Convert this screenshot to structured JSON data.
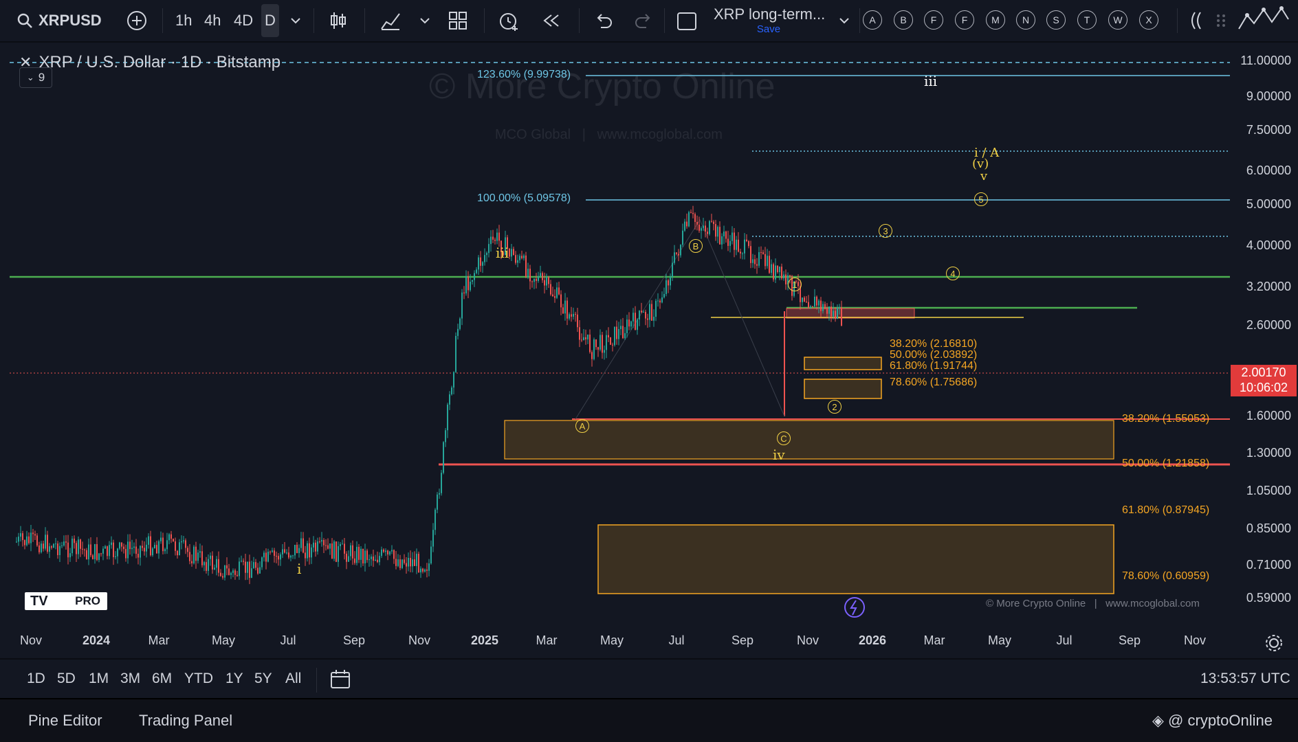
{
  "toolbar": {
    "symbol": "XRPUSD",
    "intervals": [
      "1h",
      "4h",
      "4D",
      "D"
    ],
    "active_interval": "D",
    "layout_name": "XRP long-term...",
    "save_label": "Save",
    "drawing_letters": [
      "A",
      "B",
      "F",
      "F",
      "M",
      "N",
      "S",
      "T",
      "W",
      "X"
    ]
  },
  "legend": {
    "title": "XRP / U.S. Dollar · 1D · Bitstamp",
    "indicator_count": "9"
  },
  "watermark": {
    "main": "© More Crypto Online",
    "sub": "MCO Global   |   www.mcoglobal.com",
    "footer": "© More Crypto Online   |   www.mcoglobal.com"
  },
  "price_axis": {
    "labels": [
      "11.00000",
      "9.00000",
      "7.50000",
      "6.00000",
      "5.00000",
      "4.00000",
      "3.20000",
      "2.60000",
      "1.60000",
      "1.30000",
      "1.05000",
      "0.85000",
      "0.71000",
      "0.59000"
    ],
    "current_price": "2.00170",
    "countdown": "10:06:02"
  },
  "time_axis": {
    "labels": [
      "Nov",
      "2024",
      "Mar",
      "May",
      "Jul",
      "Sep",
      "Nov",
      "2025",
      "Mar",
      "May",
      "Jul",
      "Sep",
      "Nov",
      "2026",
      "Mar",
      "May",
      "Jul",
      "Sep",
      "Nov"
    ],
    "bold": [
      "2024",
      "2025",
      "2026"
    ]
  },
  "fib_levels": {
    "ext_123": "123.60% (9.99738)",
    "ext_100": "100.00% (5.09578)",
    "small_382": "38.20% (2.16810)",
    "small_500": "50.00% (2.03892)",
    "small_618": "61.80% (1.91744)",
    "small_786": "78.60% (1.75686)",
    "big_382": "38.20% (1.55053)",
    "big_500": "50.00% (1.21858)",
    "big_618": "61.80% (0.87945)",
    "big_786": "78.60% (0.60959)"
  },
  "waves": {
    "iii_left": "iii",
    "iii_top": "iii",
    "i": "i",
    "iv": "iv",
    "v": "v",
    "v_paren": "(v)",
    "i_a": "i / A",
    "A": "A",
    "B": "B",
    "C": "C",
    "w1": "1",
    "w2": "2",
    "w3": "3",
    "w4": "4",
    "w5": "5"
  },
  "range_bar": {
    "ranges": [
      "1D",
      "5D",
      "1M",
      "3M",
      "6M",
      "YTD",
      "1Y",
      "5Y",
      "All"
    ],
    "clock": "13:53:57 UTC"
  },
  "bottom_bar": {
    "pine_editor": "Pine Editor",
    "trading_panel": "Trading Panel",
    "brand": "@ cryptoOnline"
  },
  "pro_badge": "PRO",
  "colors": {
    "background": "#131722",
    "up_candle": "#26a69a",
    "down_candle": "#ef5350",
    "fib_blue": "#6ec6e6",
    "fib_orange": "#f5a623",
    "wave_yellow": "#f0d046",
    "green_line": "#4caf50",
    "red_line": "#e23b3b"
  },
  "chart_data": {
    "type": "candlestick",
    "x_range": [
      "2023-10",
      "2026-11"
    ],
    "y_scale": "log",
    "approx_closes": [
      {
        "date": "2023-11",
        "close": 0.62
      },
      {
        "date": "2024-01",
        "close": 0.58
      },
      {
        "date": "2024-03",
        "close": 0.62
      },
      {
        "date": "2024-05",
        "close": 0.52
      },
      {
        "date": "2024-07",
        "close": 0.6
      },
      {
        "date": "2024-09",
        "close": 0.58
      },
      {
        "date": "2024-11",
        "close": 0.55
      },
      {
        "date": "2024-12",
        "close": 2.4
      },
      {
        "date": "2025-01",
        "close": 3.2
      },
      {
        "date": "2025-03",
        "close": 2.3
      },
      {
        "date": "2025-04",
        "close": 1.75
      },
      {
        "date": "2025-06",
        "close": 2.2
      },
      {
        "date": "2025-07",
        "close": 3.55
      },
      {
        "date": "2025-09",
        "close": 2.9
      },
      {
        "date": "2025-10",
        "close": 2.5
      },
      {
        "date": "2025-11",
        "close": 2.2
      },
      {
        "date": "2025-12",
        "close": 2.0
      }
    ]
  }
}
